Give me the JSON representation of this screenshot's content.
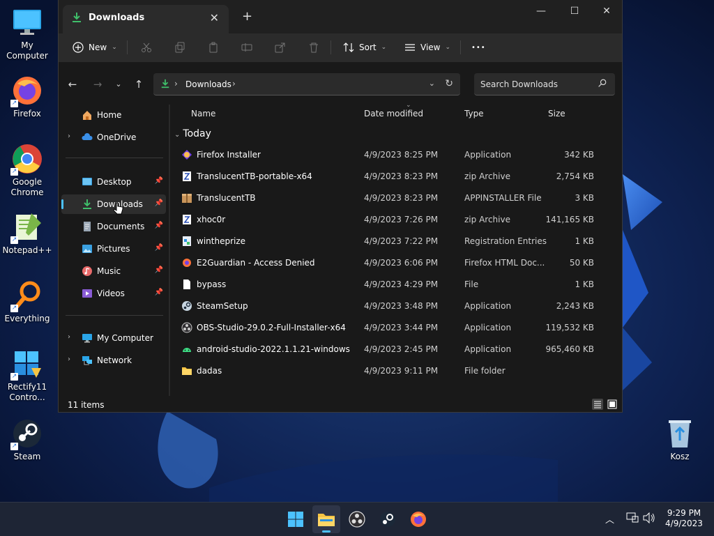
{
  "desktop": {
    "icons": [
      {
        "label": "My Computer"
      },
      {
        "label": "Firefox"
      },
      {
        "label": "Google Chrome"
      },
      {
        "label": "Notepad++"
      },
      {
        "label": "Everything"
      },
      {
        "label": "Rectify11 Contro..."
      },
      {
        "label": "Steam"
      }
    ],
    "recycle_bin": {
      "label": "Kosz"
    }
  },
  "window": {
    "tab_title": "Downloads",
    "toolbar": {
      "new_label": "New",
      "sort_label": "Sort",
      "view_label": "View",
      "more_label": "•••"
    },
    "address": {
      "crumb": "Downloads"
    },
    "search": {
      "placeholder": "Search Downloads"
    },
    "nav": {
      "home": "Home",
      "onedrive": "OneDrive",
      "quick": [
        {
          "label": "Desktop"
        },
        {
          "label": "Downloads"
        },
        {
          "label": "Documents"
        },
        {
          "label": "Pictures"
        },
        {
          "label": "Music"
        },
        {
          "label": "Videos"
        }
      ],
      "my_computer": "My Computer",
      "network": "Network"
    },
    "columns": {
      "name": "Name",
      "date": "Date modified",
      "type": "Type",
      "size": "Size"
    },
    "group_label": "Today",
    "files": [
      {
        "name": "Firefox Installer",
        "date": "4/9/2023 8:25 PM",
        "type": "Application",
        "size": "342 KB",
        "icon": "firefox-installer-icon"
      },
      {
        "name": "TranslucentTB-portable-x64",
        "date": "4/9/2023 8:23 PM",
        "type": "zip Archive",
        "size": "2,754 KB",
        "icon": "zip-icon"
      },
      {
        "name": "TranslucentTB",
        "date": "4/9/2023 8:23 PM",
        "type": "APPINSTALLER File",
        "size": "3 KB",
        "icon": "package-icon"
      },
      {
        "name": "xhoc0r",
        "date": "4/9/2023 7:26 PM",
        "type": "zip Archive",
        "size": "141,165 KB",
        "icon": "zip-icon"
      },
      {
        "name": "wintheprize",
        "date": "4/9/2023 7:22 PM",
        "type": "Registration Entries",
        "size": "1 KB",
        "icon": "registry-icon"
      },
      {
        "name": "E2Guardian - Access Denied",
        "date": "4/9/2023 6:06 PM",
        "type": "Firefox HTML Doc...",
        "size": "50 KB",
        "icon": "firefox-html-icon"
      },
      {
        "name": "bypass",
        "date": "4/9/2023 4:29 PM",
        "type": "File",
        "size": "1 KB",
        "icon": "file-icon"
      },
      {
        "name": "SteamSetup",
        "date": "4/9/2023 3:48 PM",
        "type": "Application",
        "size": "2,243 KB",
        "icon": "steam-icon"
      },
      {
        "name": "OBS-Studio-29.0.2-Full-Installer-x64",
        "date": "4/9/2023 3:44 PM",
        "type": "Application",
        "size": "119,532 KB",
        "icon": "obs-icon"
      },
      {
        "name": "android-studio-2022.1.1.21-windows",
        "date": "4/9/2023 2:45 PM",
        "type": "Application",
        "size": "965,460 KB",
        "icon": "android-icon"
      },
      {
        "name": "dadas",
        "date": "4/9/2023 9:11 PM",
        "type": "File folder",
        "size": "",
        "icon": "folder-icon"
      }
    ],
    "status": {
      "count": "11 items"
    }
  },
  "taskbar": {
    "clock_time": "9:29 PM",
    "clock_date": "4/9/2023"
  },
  "colors": {
    "accent": "#4cc2ff",
    "download_green": "#3fbf6a",
    "folder_yellow": "#f5c443"
  }
}
